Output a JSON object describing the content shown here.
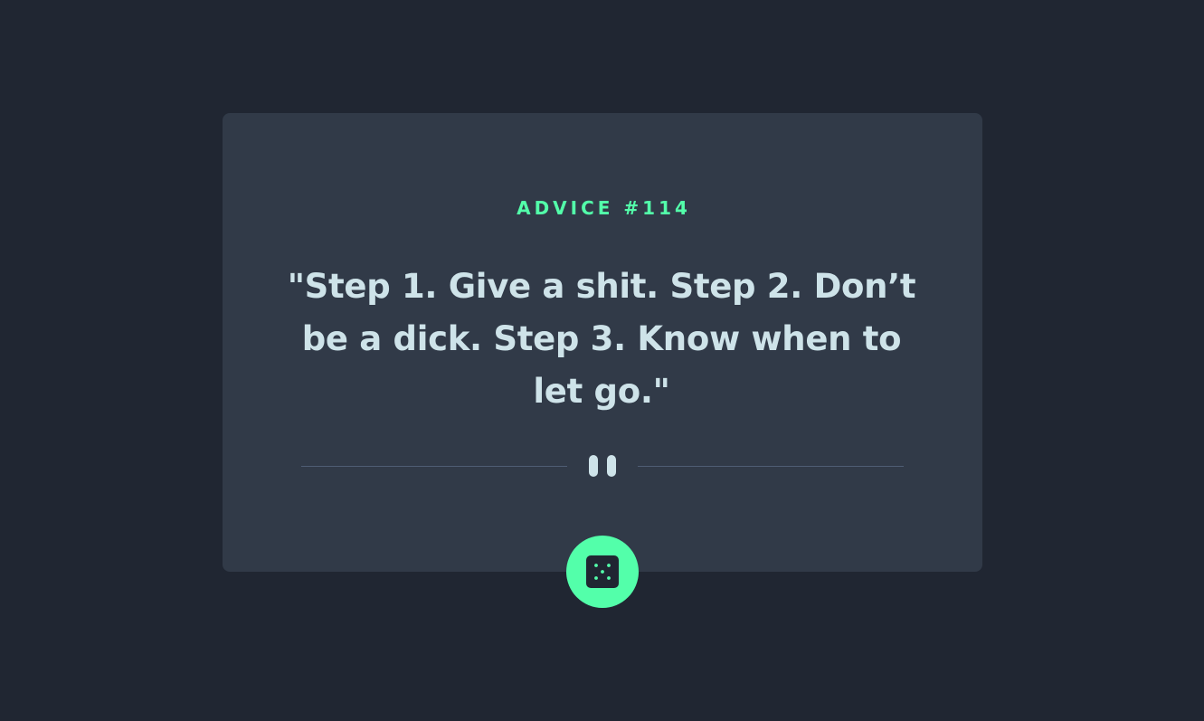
{
  "advice": {
    "id_label": "ADVICE #114",
    "quote": "\"Step 1. Give a shit. Step 2. Don’t be a dick. Step 3. Know when to let go.\""
  },
  "divider": {
    "icon": "pause-icon"
  },
  "dice_button": {
    "icon": "dice-icon"
  },
  "colors": {
    "background": "#202632",
    "card": "#313A48",
    "accent": "#53FFAA",
    "text": "#CEE3E9",
    "divider_line": "#4F5D74"
  }
}
